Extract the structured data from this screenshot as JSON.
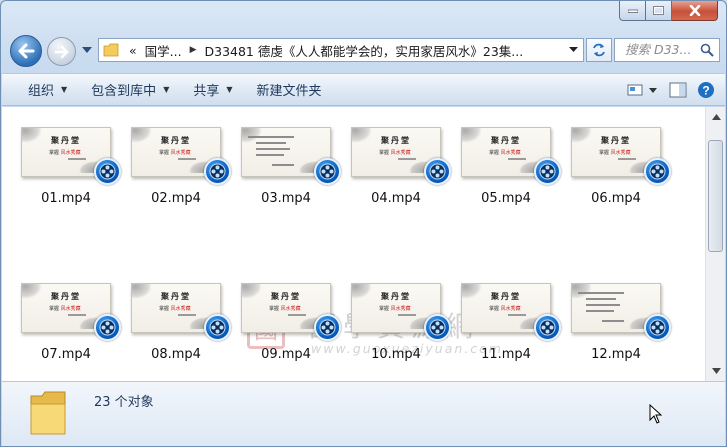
{
  "address": {
    "overflow": "«",
    "segments": [
      "国学...",
      "D33481 德虔《人人都能学会的，实用家居风水》23集..."
    ]
  },
  "search": {
    "placeholder": "搜索 D33..."
  },
  "commands": [
    {
      "label": "组织",
      "dropdown": true
    },
    {
      "label": "包含到库中",
      "dropdown": true
    },
    {
      "label": "共享",
      "dropdown": true
    },
    {
      "label": "新建文件夹",
      "dropdown": false
    }
  ],
  "files": [
    {
      "name": "01.mp4",
      "variant": "title"
    },
    {
      "name": "02.mp4",
      "variant": "title"
    },
    {
      "name": "03.mp4",
      "variant": "text"
    },
    {
      "name": "04.mp4",
      "variant": "title"
    },
    {
      "name": "05.mp4",
      "variant": "title"
    },
    {
      "name": "06.mp4",
      "variant": "title"
    },
    {
      "name": "07.mp4",
      "variant": "title"
    },
    {
      "name": "08.mp4",
      "variant": "title"
    },
    {
      "name": "09.mp4",
      "variant": "title"
    },
    {
      "name": "10.mp4",
      "variant": "title"
    },
    {
      "name": "11.mp4",
      "variant": "title"
    },
    {
      "name": "12.mp4",
      "variant": "text"
    }
  ],
  "thumbnail": {
    "title": "聚丹堂",
    "lecturer_label": "掌握",
    "lecturer_name": "风水秀藏"
  },
  "watermark": {
    "title": "國學資源網",
    "url": "www.guoxueziyuan.com"
  },
  "status": {
    "count_text": "23 个对象"
  },
  "colors": {
    "accent": "#1e395b",
    "player": "#0a5fc2"
  }
}
